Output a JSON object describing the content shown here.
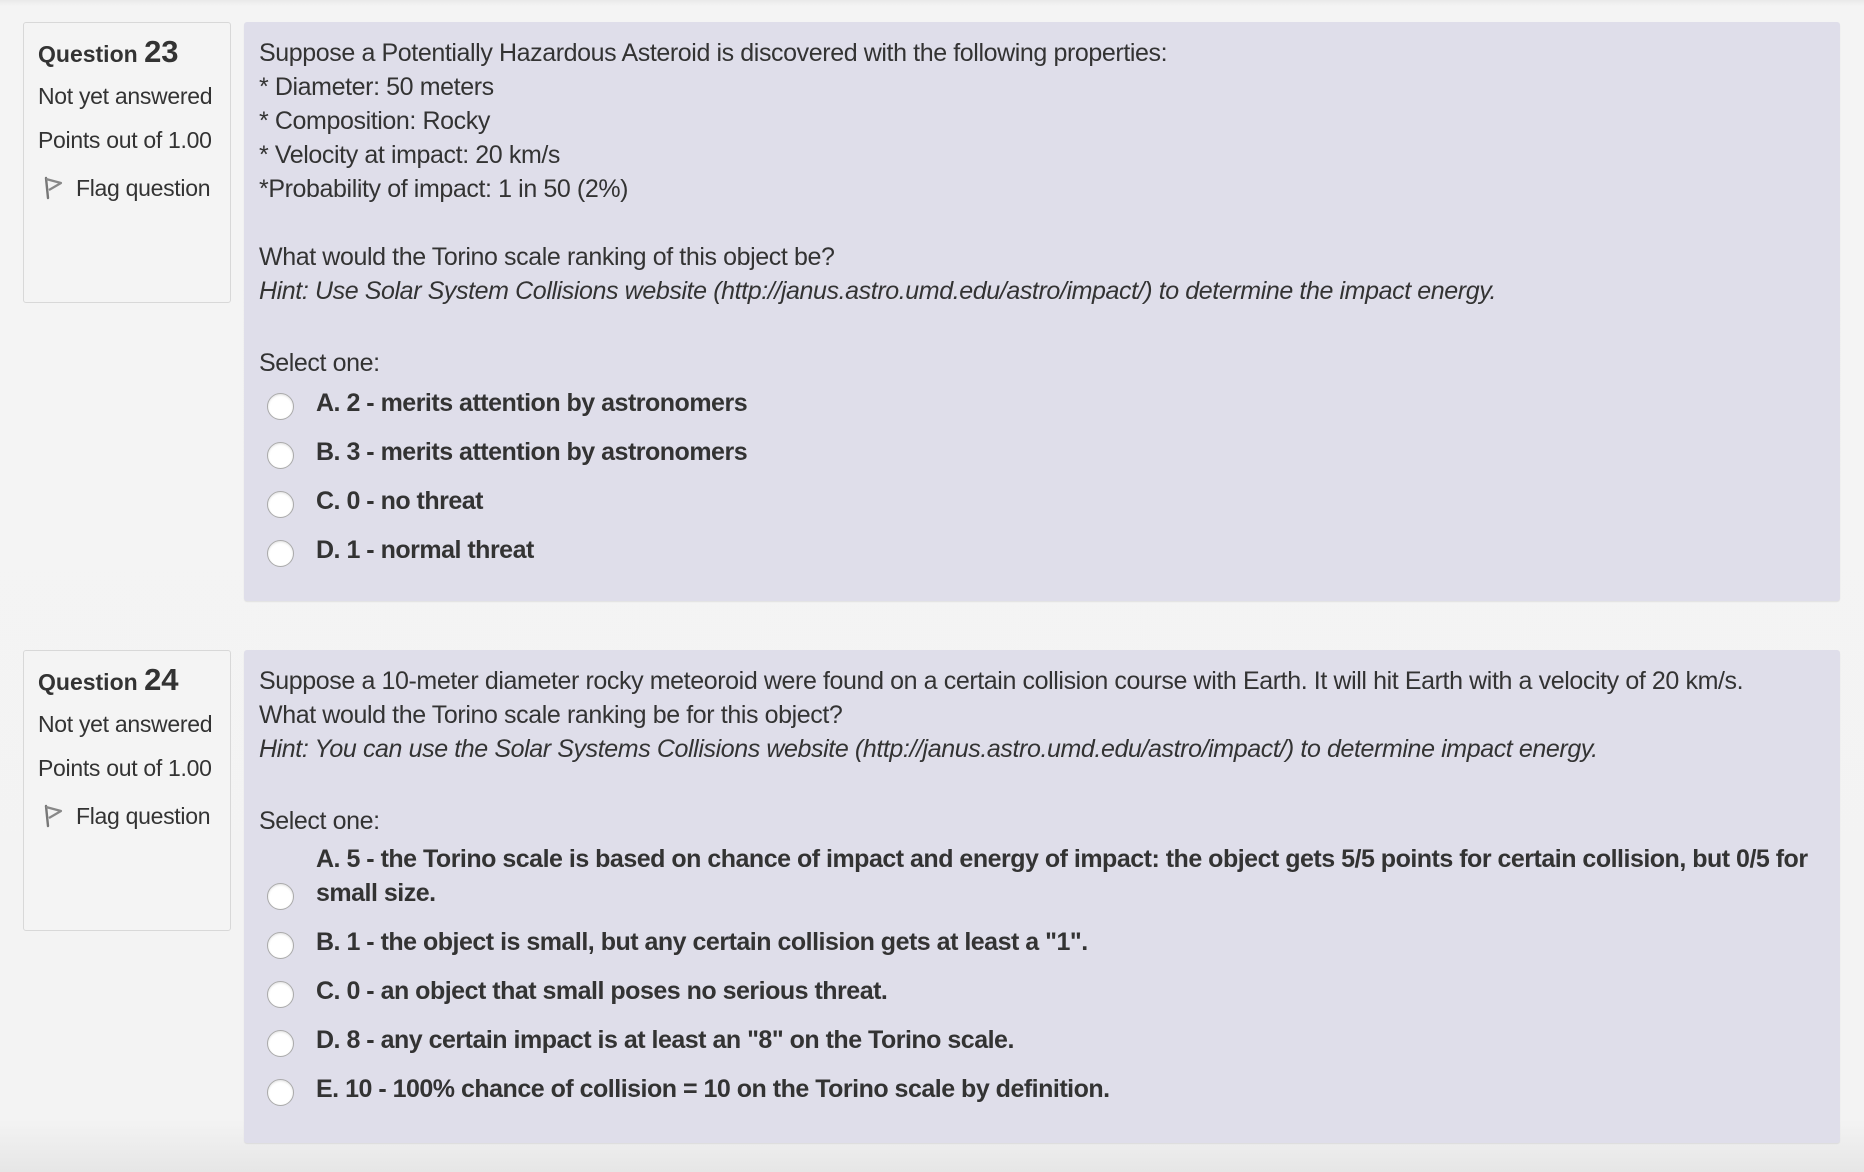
{
  "questions": [
    {
      "label": "Question",
      "number": "23",
      "state": "Not yet answered",
      "grade": "Points out of 1.00",
      "flag_label": "Flag question",
      "text_lines": [
        "Suppose a Potentially Hazardous Asteroid is discovered with the following properties:",
        "* Diameter: 50 meters",
        "* Composition: Rocky",
        "* Velocity at impact: 20 km/s",
        "*Probability of impact: 1 in 50 (2%)"
      ],
      "question": "What would the Torino scale ranking of this object be?",
      "hint": "Hint: Use Solar System Collisions website (http://janus.astro.umd.edu/astro/impact/) to determine the impact energy.",
      "prompt": "Select one:",
      "options": [
        {
          "label": "A. 2 - merits attention by astronomers",
          "selected": false
        },
        {
          "label": "B. 3 - merits attention by astronomers",
          "selected": false
        },
        {
          "label": "C. 0 - no threat",
          "selected": false
        },
        {
          "label": "D. 1 - normal threat",
          "selected": false
        }
      ]
    },
    {
      "label": "Question",
      "number": "24",
      "state": "Not yet answered",
      "grade": "Points out of 1.00",
      "flag_label": "Flag question",
      "text": "Suppose a 10-meter diameter rocky meteoroid were found on a certain collision course with Earth. It will hit Earth with a velocity of 20 km/s. What would the Torino scale ranking be for this object?",
      "hint": "Hint: You can use the Solar Systems Collisions website (http://janus.astro.umd.edu/astro/impact/) to determine impact energy.",
      "prompt": "Select one:",
      "options": [
        {
          "label": "A. 5 - the Torino scale is based on chance of impact and energy of impact: the object gets 5/5 points for certain collision, but 0/5 for small size.",
          "selected": false
        },
        {
          "label": "B. 1 - the object is small, but any certain collision gets at least a \"1\".",
          "selected": false
        },
        {
          "label": "C. 0 - an object that small poses no serious threat.",
          "selected": false
        },
        {
          "label": "D. 8 - any certain impact is at least an \"8\" on the Torino scale.",
          "selected": false
        },
        {
          "label": "E. 10 - 100% chance of collision = 10 on the Torino scale by definition.",
          "selected": false
        }
      ]
    }
  ],
  "colors": {
    "page_bg": "#f4f4f4",
    "content_bg": "#dfdeea",
    "text": "#333333"
  }
}
